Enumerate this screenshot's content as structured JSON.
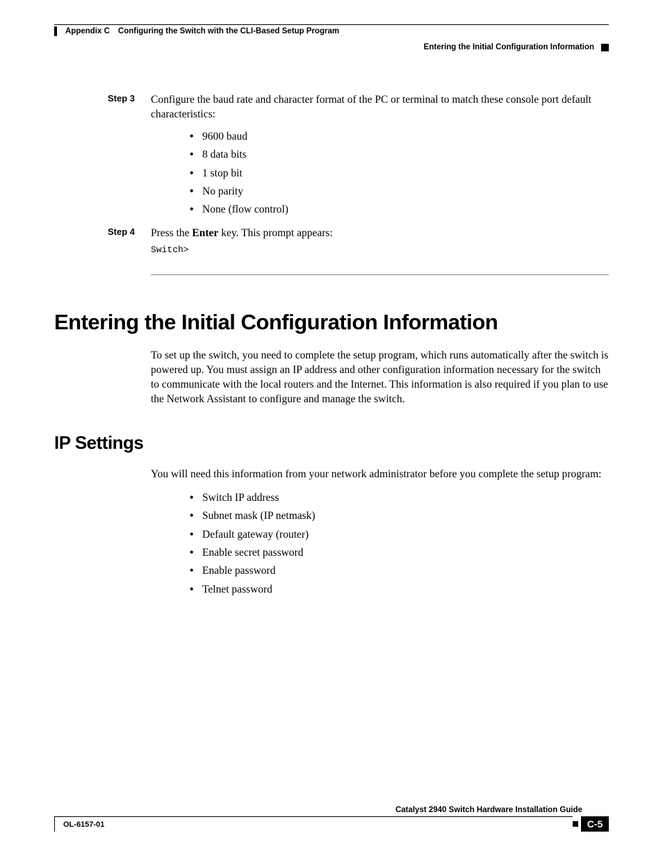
{
  "header": {
    "appendix": "Appendix C",
    "title": "Configuring the Switch with the CLI-Based Setup Program",
    "section": "Entering the Initial Configuration Information"
  },
  "step3": {
    "label": "Step 3",
    "text": "Configure the baud rate and character format of the PC or terminal to match these console port default characteristics:",
    "bullets": [
      "9600 baud",
      "8 data bits",
      "1 stop bit",
      "No parity",
      "None (flow control)"
    ]
  },
  "step4": {
    "label": "Step 4",
    "text_pre": "Press the ",
    "text_bold": "Enter",
    "text_post": " key. This prompt appears:",
    "code": "Switch>"
  },
  "h1": "Entering the Initial Configuration Information",
  "p1": "To set up the switch, you need to complete the setup program, which runs automatically after the switch is powered up. You must assign an IP address and other configuration information necessary for the switch to communicate with the local routers and the Internet. This information is also required if you plan to use the Network Assistant to configure and manage the switch.",
  "h2": "IP Settings",
  "p2": "You will need this information from your network administrator before you complete the setup program:",
  "ip_bullets": [
    "Switch IP address",
    "Subnet mask (IP netmask)",
    "Default gateway (router)",
    "Enable secret password",
    "Enable password",
    "Telnet password"
  ],
  "footer": {
    "guide": "Catalyst 2940 Switch Hardware Installation Guide",
    "doc": "OL-6157-01",
    "page": "C-5"
  }
}
